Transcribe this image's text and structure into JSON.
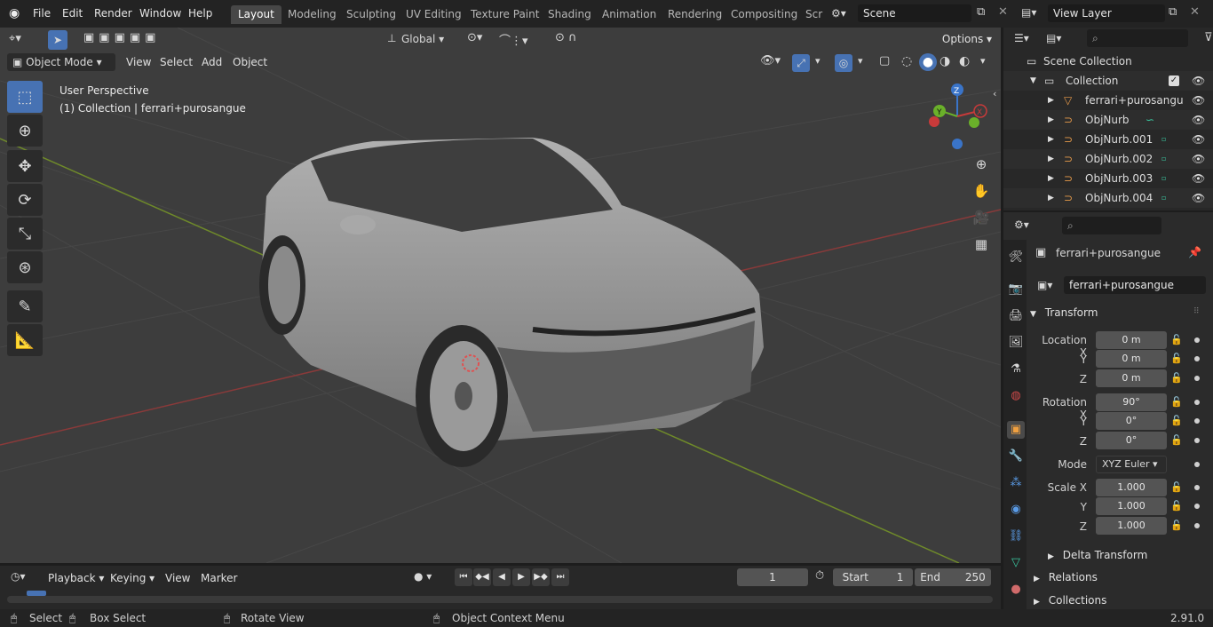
{
  "menu": [
    "File",
    "Edit",
    "Render",
    "Window",
    "Help"
  ],
  "workspaces": [
    {
      "label": "Layout",
      "active": true
    },
    {
      "label": "Modeling"
    },
    {
      "label": "Sculpting"
    },
    {
      "label": "UV Editing"
    },
    {
      "label": "Texture Paint"
    },
    {
      "label": "Shading"
    },
    {
      "label": "Animation"
    },
    {
      "label": "Rendering"
    },
    {
      "label": "Compositing"
    },
    {
      "label": "Scr"
    }
  ],
  "scene_field": "Scene",
  "view_layer_field": "View Layer",
  "viewport": {
    "transform_orientation": "Global",
    "options_label": "Options",
    "mode": "Object Mode",
    "header_menu": [
      "View",
      "Select",
      "Add",
      "Object"
    ],
    "perspective_label": "User Perspective",
    "collection_label": "(1) Collection | ferrari+purosangue",
    "gizmo_axes": {
      "x": "X",
      "y": "Y",
      "z": "Z"
    }
  },
  "outliner": {
    "rows": [
      {
        "label": "Scene Collection",
        "indent": 0
      },
      {
        "label": "Collection",
        "indent": 1
      },
      {
        "label": "ferrari+purosangu",
        "indent": 2
      },
      {
        "label": "ObjNurb",
        "indent": 2
      },
      {
        "label": "ObjNurb.001",
        "indent": 2
      },
      {
        "label": "ObjNurb.002",
        "indent": 2
      },
      {
        "label": "ObjNurb.003",
        "indent": 2
      },
      {
        "label": "ObjNurb.004",
        "indent": 2
      }
    ]
  },
  "properties": {
    "object_name": "ferrari+purosangue",
    "data_name": "ferrari+purosangue",
    "transform_header": "Transform",
    "location": {
      "label": "Location X",
      "x": "0 m",
      "y": "0 m",
      "z": "0 m"
    },
    "rotation": {
      "label": "Rotation X",
      "x": "90°",
      "y": "0°",
      "z": "0°"
    },
    "mode_label": "Mode",
    "mode_value": "XYZ Euler",
    "scale": {
      "label": "Scale X",
      "x": "1.000",
      "y": "1.000",
      "z": "1.000"
    },
    "axis_y": "Y",
    "axis_z": "Z",
    "delta_transform": "Delta Transform",
    "relations": "Relations",
    "collections": "Collections"
  },
  "timeline": {
    "menu": [
      "Playback",
      "Keying",
      "View",
      "Marker"
    ],
    "current_frame": "1",
    "start_label": "Start",
    "start_value": "1",
    "end_label": "End",
    "end_value": "250"
  },
  "statusbar": {
    "select": "Select",
    "box_select": "Box Select",
    "rotate_view": "Rotate View",
    "context_menu": "Object Context Menu",
    "version": "2.91.0"
  }
}
